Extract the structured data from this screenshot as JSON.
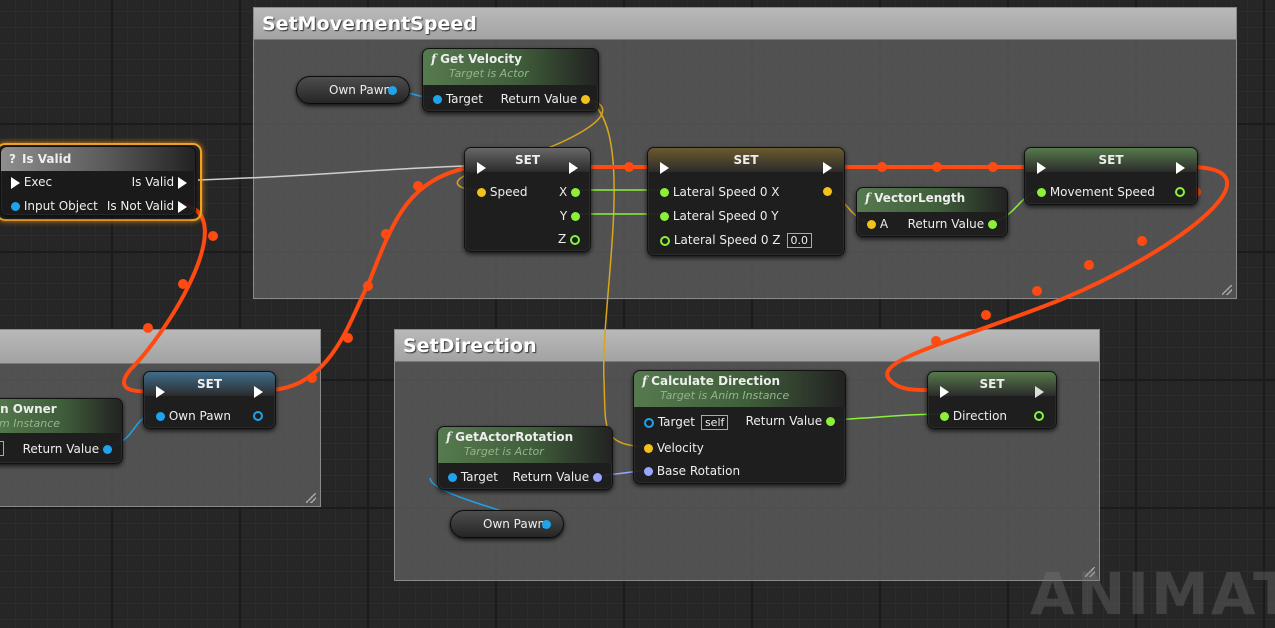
{
  "colors": {
    "exec_wire": "#ff4a12",
    "float_pin": "#8cf03a",
    "vector_pin": "#f2c11a",
    "object_pin": "#1fa3ee",
    "rotator_pin": "#9aa5ff",
    "exec_pin": "#ffffff",
    "function_header": "#567a4f",
    "highlight": "#f5a524"
  },
  "comments": {
    "set_movement_speed": "SetMovementSpeed",
    "set_direction": "SetDirection"
  },
  "is_valid": {
    "icon": "question-icon",
    "title": "Is Valid",
    "exec": "Exec",
    "input_object": "Input Object",
    "is_valid_out": "Is Valid",
    "is_not_valid_out": "Is Not Valid"
  },
  "own_pawn_var_top": "Own Pawn",
  "get_velocity": {
    "title": "Get Velocity",
    "subtitle": "Target is Actor",
    "target": "Target",
    "return_value": "Return Value"
  },
  "set_speed": {
    "title": "SET",
    "speed": "Speed",
    "x": "X",
    "y": "Y",
    "z": "Z"
  },
  "set_lateral": {
    "title": "SET",
    "x": "Lateral Speed 0 X",
    "y": "Lateral Speed 0 Y",
    "z": "Lateral Speed 0 Z",
    "z_value": "0.0"
  },
  "vector_length": {
    "title": "VectorLength",
    "a": "A",
    "return_value": "Return Value"
  },
  "set_movement": {
    "title": "SET",
    "movement_speed": "Movement Speed"
  },
  "pawn_owner": {
    "title": "wn Owner",
    "subtitle": "nim Instance",
    "self": "lf",
    "return_value": "Return Value"
  },
  "set_own_pawn": {
    "title": "SET",
    "own_pawn": "Own Pawn"
  },
  "calc_direction": {
    "title": "Calculate Direction",
    "subtitle": "Target is Anim Instance",
    "target": "Target",
    "self": "self",
    "return_value": "Return Value",
    "velocity": "Velocity",
    "base_rotation": "Base Rotation"
  },
  "set_direction_node": {
    "title": "SET",
    "direction": "Direction"
  },
  "get_actor_rotation": {
    "title": "GetActorRotation",
    "subtitle": "Target is Actor",
    "target": "Target",
    "return_value": "Return Value"
  },
  "own_pawn_var_bottom": "Own Pawn",
  "watermark": "ANIMATIC"
}
